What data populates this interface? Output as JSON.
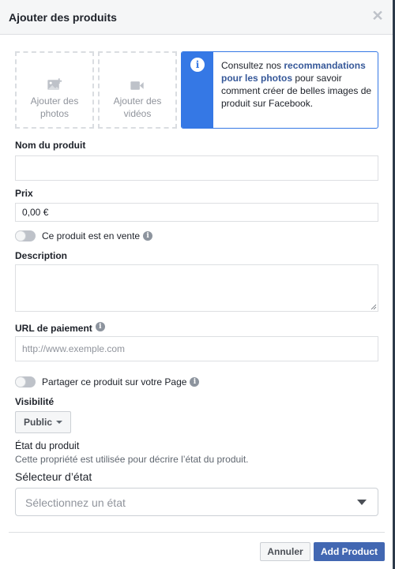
{
  "dialog": {
    "title": "Ajouter des produits",
    "close_icon": "close-icon"
  },
  "media": {
    "photos_label": "Ajouter des photos",
    "videos_label": "Ajouter des vidéos",
    "photos_icon": "add-photo-icon",
    "videos_icon": "video-camera-icon"
  },
  "info_card": {
    "icon": "info-icon",
    "text_before": "Consultez nos ",
    "link_text": "recommandations pour les photos",
    "text_after": " pour savoir comment créer de belles images de produit sur Facebook.",
    "accent_color": "#3578e5"
  },
  "form": {
    "name_label": "Nom du produit",
    "name_value": "",
    "price_label": "Prix",
    "price_value": "0,00 €",
    "on_sale_label": "Ce produit est en vente",
    "on_sale_enabled": false,
    "description_label": "Description",
    "description_value": "",
    "payment_url_label": "URL de paiement",
    "payment_url_placeholder": "http://www.exemple.com",
    "share_label": "Partager ce produit sur votre Page",
    "share_enabled": false,
    "visibility_label": "Visibilité",
    "visibility_value": "Public",
    "condition_title": "État du produit",
    "condition_help": "Cette propriété est utilisée pour décrire l’état du produit.",
    "condition_selector_label": "Sélecteur d’état",
    "condition_placeholder": "Sélectionnez un état"
  },
  "footer": {
    "cancel_label": "Annuler",
    "submit_label": "Add Product",
    "primary_color": "#4267b2"
  }
}
